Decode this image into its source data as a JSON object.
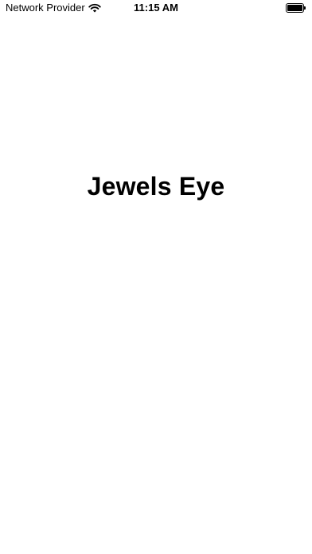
{
  "status_bar": {
    "carrier": "Network Provider",
    "time": "11:15 AM",
    "wifi_icon": "wifi-icon",
    "battery_icon": "battery-icon",
    "battery_level": 1.0
  },
  "main": {
    "title": "Jewels Eye"
  }
}
